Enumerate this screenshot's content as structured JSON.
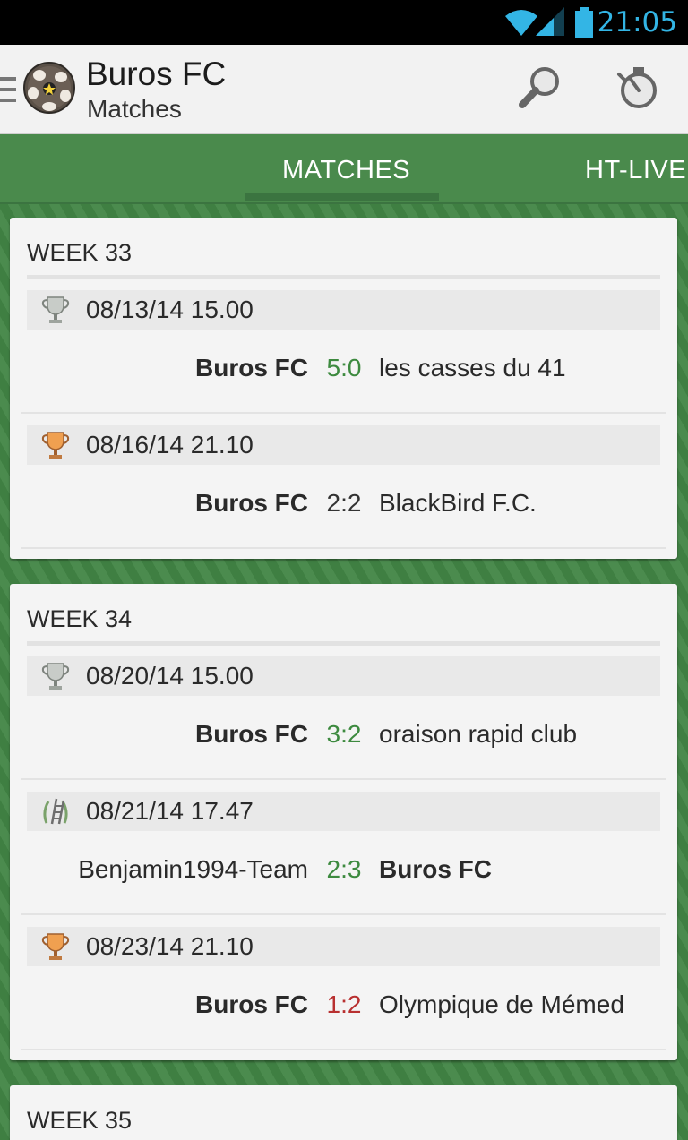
{
  "status_bar": {
    "time": "21:05",
    "icons": [
      "wifi-icon",
      "signal-icon",
      "battery-icon"
    ]
  },
  "action_bar": {
    "title": "Buros FC",
    "subtitle": "Matches",
    "icons": [
      "drawer-menu-icon",
      "club-logo",
      "search-icon",
      "stopwatch-icon"
    ]
  },
  "tabs": [
    {
      "label": "MATCHES",
      "selected": true
    },
    {
      "label": "HT-LIVE",
      "selected": false
    }
  ],
  "colors": {
    "win": "#3d8a3f",
    "draw": "#333333",
    "loss": "#b83030",
    "green": "#4a8a4c"
  },
  "weeks": [
    {
      "title": "WEEK 33",
      "matches": [
        {
          "date": "08/13/14 15.00",
          "icon": "trophy-silver-icon",
          "home": "Buros FC",
          "score": "5:0",
          "away": "les casses du 41",
          "result": "win",
          "bold": "home"
        },
        {
          "date": "08/16/14 21.10",
          "icon": "trophy-orange-icon",
          "home": "Buros FC",
          "score": "2:2",
          "away": "BlackBird F.C.",
          "result": "draw",
          "bold": "home"
        }
      ]
    },
    {
      "title": "WEEK 34",
      "matches": [
        {
          "date": "08/20/14 15.00",
          "icon": "trophy-silver-icon",
          "home": "Buros FC",
          "score": "3:2",
          "away": "oraison rapid club",
          "result": "win",
          "bold": "home"
        },
        {
          "date": "08/21/14 17.47",
          "icon": "ladder-icon",
          "home": "Benjamin1994-Team",
          "score": "2:3",
          "away": "Buros FC",
          "result": "win",
          "bold": "away"
        },
        {
          "date": "08/23/14 21.10",
          "icon": "trophy-orange-icon",
          "home": "Buros FC",
          "score": "1:2",
          "away": "Olympique de Mémed",
          "result": "loss",
          "bold": "home"
        }
      ]
    },
    {
      "title": "WEEK 35",
      "matches": []
    }
  ]
}
